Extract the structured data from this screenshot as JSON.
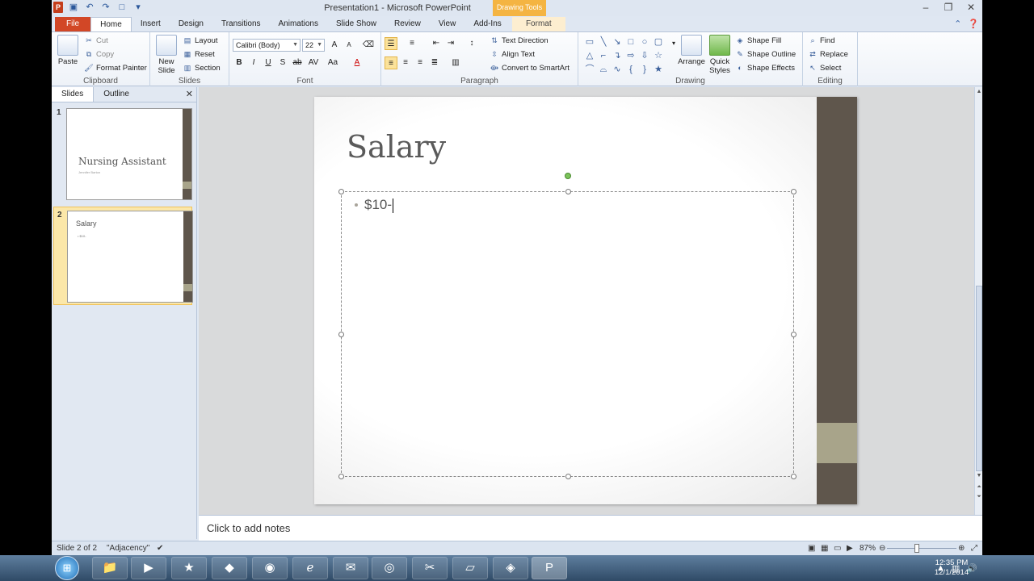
{
  "window": {
    "title": "Presentation1 - Microsoft PowerPoint",
    "contextual_tab_group": "Drawing Tools"
  },
  "tabs": [
    "File",
    "Home",
    "Insert",
    "Design",
    "Transitions",
    "Animations",
    "Slide Show",
    "Review",
    "View",
    "Add-Ins",
    "Format"
  ],
  "ribbon": {
    "clipboard": {
      "label": "Clipboard",
      "paste": "Paste",
      "cut": "Cut",
      "copy": "Copy",
      "format_painter": "Format Painter"
    },
    "slides": {
      "label": "Slides",
      "new_slide": "New Slide",
      "layout": "Layout",
      "reset": "Reset",
      "section": "Section"
    },
    "font": {
      "label": "Font",
      "font_name": "Calibri (Body)",
      "font_size": "22"
    },
    "paragraph": {
      "label": "Paragraph",
      "text_direction": "Text Direction",
      "align_text": "Align Text",
      "convert_smartart": "Convert to SmartArt"
    },
    "drawing": {
      "label": "Drawing",
      "arrange": "Arrange",
      "quick_styles": "Quick Styles",
      "shape_fill": "Shape Fill",
      "shape_outline": "Shape Outline",
      "shape_effects": "Shape Effects"
    },
    "editing": {
      "label": "Editing",
      "find": "Find",
      "replace": "Replace",
      "select": "Select"
    }
  },
  "panel": {
    "tabs": [
      "Slides",
      "Outline"
    ],
    "thumbnails": [
      {
        "num": "1",
        "title": "Nursing Assistant",
        "subtitle": "Jennifer Barton"
      },
      {
        "num": "2",
        "title": "Salary",
        "bullet": "$10-"
      }
    ]
  },
  "slide": {
    "title": "Salary",
    "bullet": "$10-"
  },
  "notes": {
    "placeholder": "Click to add notes"
  },
  "status": {
    "slide_info": "Slide 2 of 2",
    "theme": "\"Adjacency\"",
    "zoom": "87%"
  },
  "taskbar": {
    "time": "12:35 PM",
    "date": "12/1/2014"
  },
  "colors": {
    "accent_dark": "#5f564c",
    "accent_light": "#a8a48a",
    "file_tab": "#d24726",
    "contextual": "#f4b442"
  }
}
